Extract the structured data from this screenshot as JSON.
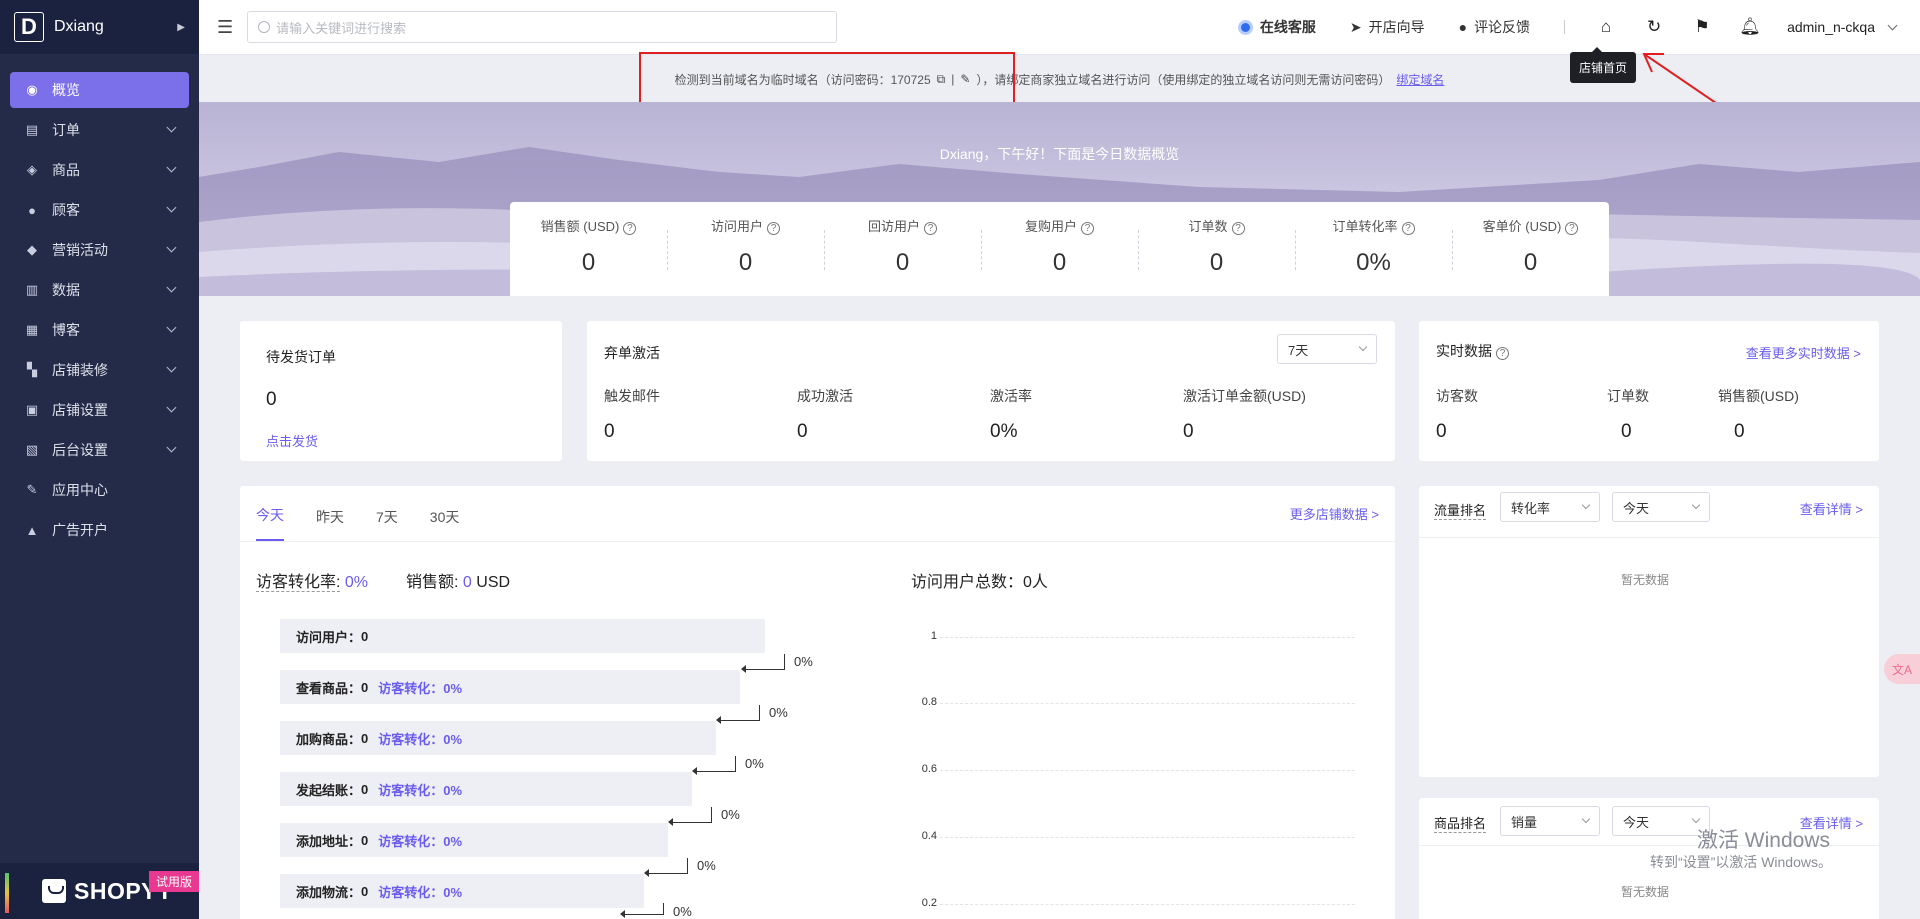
{
  "brand": {
    "initial": "D",
    "name": "Dxiang"
  },
  "sidebar": {
    "items": [
      {
        "label": "概览",
        "icon": "dashboard-icon",
        "active": true
      },
      {
        "label": "订单",
        "icon": "orders-icon"
      },
      {
        "label": "商品",
        "icon": "products-icon"
      },
      {
        "label": "顾客",
        "icon": "customers-icon"
      },
      {
        "label": "营销活动",
        "icon": "marketing-icon"
      },
      {
        "label": "数据",
        "icon": "data-icon"
      },
      {
        "label": "博客",
        "icon": "blog-icon"
      },
      {
        "label": "店铺装修",
        "icon": "paint-icon"
      },
      {
        "label": "店铺设置",
        "icon": "store-settings-icon"
      },
      {
        "label": "后台设置",
        "icon": "admin-settings-icon"
      },
      {
        "label": "应用中心",
        "icon": "apps-icon"
      },
      {
        "label": "广告开户",
        "icon": "ads-icon"
      }
    ],
    "footer_logo": "SHOPYY",
    "trial_badge": "试用版"
  },
  "topbar": {
    "search_placeholder": "请输入关键词进行搜索",
    "customer_service": "在线客服",
    "store_guide": "开店向导",
    "feedback": "评论反馈",
    "user": "admin_n-ckqa",
    "tooltip": "店铺首页"
  },
  "notice": {
    "prefix": "检测到当前域名为临时域名（访问密码：170725",
    "divider": "|",
    "suffix": "），请绑定商家独立域名进行访问（使用绑定的独立域名访问则无需访问密码）",
    "link": "绑定域名"
  },
  "hero": {
    "greeting": "Dxiang，下午好！下面是今日数据概览"
  },
  "stats": [
    {
      "label": "销售额 (USD)",
      "value": "0"
    },
    {
      "label": "访问用户",
      "value": "0"
    },
    {
      "label": "回访用户",
      "value": "0"
    },
    {
      "label": "复购用户",
      "value": "0"
    },
    {
      "label": "订单数",
      "value": "0"
    },
    {
      "label": "订单转化率",
      "value": "0%"
    },
    {
      "label": "客单价 (USD)",
      "value": "0"
    }
  ],
  "pending": {
    "title": "待发货订单",
    "value": "0",
    "link": "点击发货"
  },
  "abandoned": {
    "title": "弃单激活",
    "range": "7天",
    "cols": [
      {
        "label": "触发邮件",
        "value": "0"
      },
      {
        "label": "成功激活",
        "value": "0"
      },
      {
        "label": "激活率",
        "value": "0%"
      },
      {
        "label": "激活订单金额(USD)",
        "value": "0"
      }
    ]
  },
  "realtime": {
    "title": "实时数据",
    "link": "查看更多实时数据 >",
    "cols": [
      {
        "label": "访客数",
        "value": "0"
      },
      {
        "label": "订单数",
        "value": "0"
      },
      {
        "label": "销售额(USD)",
        "value": "0"
      }
    ]
  },
  "store_data": {
    "tabs": [
      "今天",
      "昨天",
      "7天",
      "30天"
    ],
    "more_link": "更多店铺数据 >",
    "conv_label": "访客转化率:",
    "conv_value": "0%",
    "sales_label": "销售额:",
    "sales_value": "0",
    "sales_unit": "USD",
    "visitors_total": "访问用户总数：0人",
    "funnel": [
      {
        "label": "访问用户：",
        "value": "0",
        "conv": ""
      },
      {
        "label": "查看商品：",
        "value": "0",
        "conv": "访客转化：0%"
      },
      {
        "label": "加购商品：",
        "value": "0",
        "conv": "访客转化：0%"
      },
      {
        "label": "发起结账：",
        "value": "0",
        "conv": "访客转化：0%"
      },
      {
        "label": "添加地址：",
        "value": "0",
        "conv": "访客转化：0%"
      },
      {
        "label": "添加物流：",
        "value": "0",
        "conv": "访客转化：0%"
      }
    ],
    "funnel_steps": [
      "0%",
      "0%",
      "0%",
      "0%",
      "0%",
      "0%"
    ],
    "y_ticks": [
      "1",
      "0.8",
      "0.6",
      "0.4",
      "0.2"
    ]
  },
  "traffic_rank": {
    "title": "流量排名",
    "metric": "转化率",
    "range": "今天",
    "link": "查看详情 >",
    "empty": "暂无数据"
  },
  "product_rank": {
    "title": "商品排名",
    "metric": "销量",
    "range": "今天",
    "link": "查看详情 >",
    "empty": "暂无数据"
  },
  "os_watermark": {
    "line1": "激活 Windows",
    "line2": "转到“设置”以激活 Windows。"
  },
  "translate_button": "文A",
  "colors": {
    "accent": "#6a5cf0",
    "sidebar": "#232b48",
    "active_nav": "#7b70ea",
    "highlight_box": "#e02020"
  }
}
